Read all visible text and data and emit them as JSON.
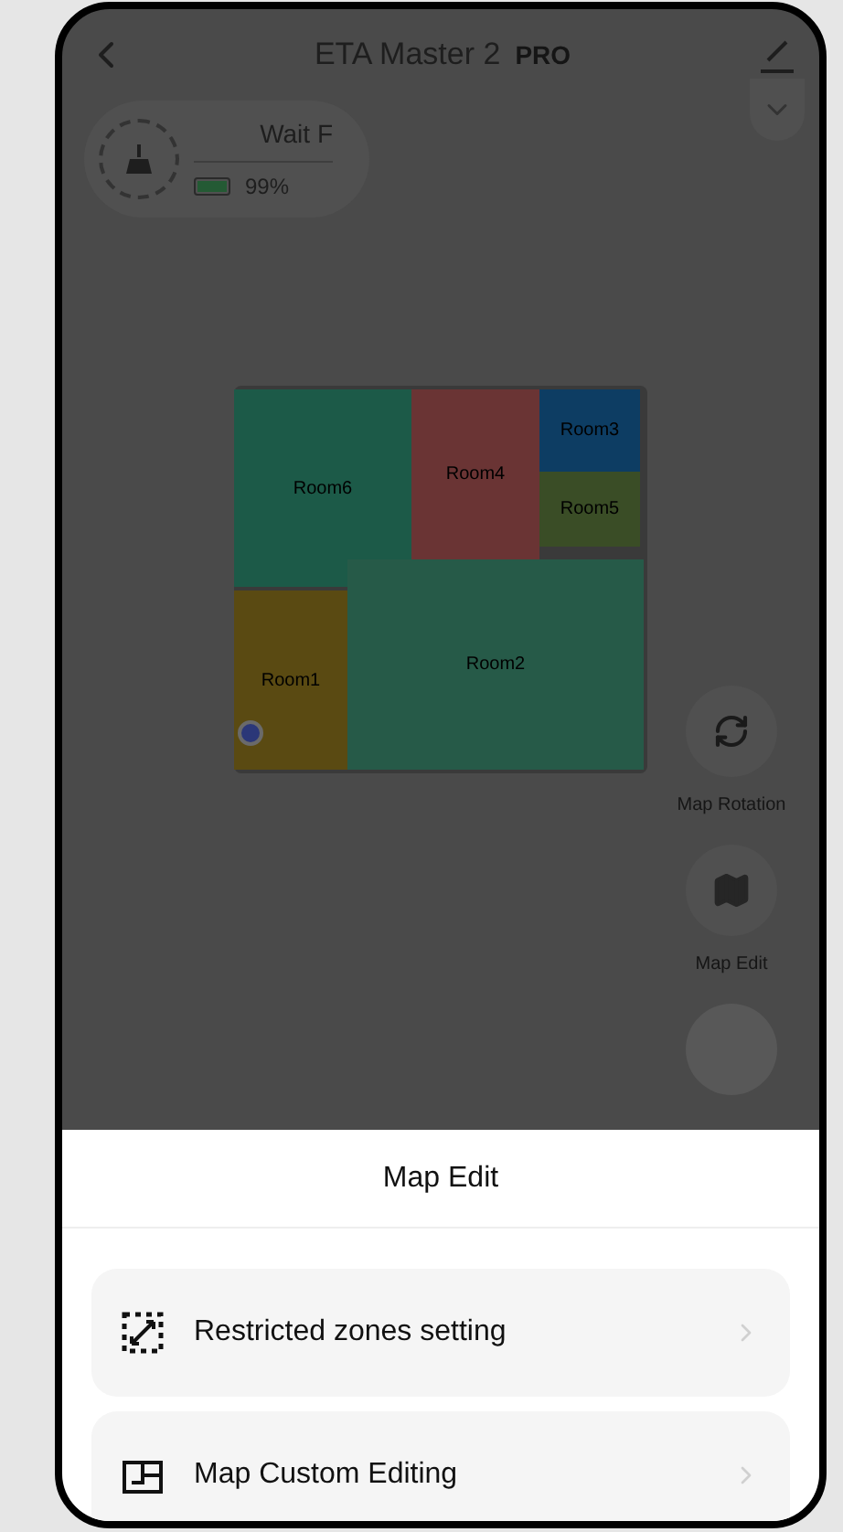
{
  "header": {
    "title": "ETA Master 2",
    "badge": "PRO"
  },
  "status": {
    "state": "Wait F",
    "battery": "99%",
    "level": 0.99
  },
  "rooms": [
    {
      "name": "Room6",
      "color": "#1c5a48"
    },
    {
      "name": "Room4",
      "color": "#6a3434"
    },
    {
      "name": "Room3",
      "color": "#0d3d63"
    },
    {
      "name": "Room5",
      "color": "#3a4d26"
    },
    {
      "name": "Room1",
      "color": "#5a4a12"
    },
    {
      "name": "Room2",
      "color": "#265a48"
    }
  ],
  "side_actions": [
    {
      "label": "Map Rotation",
      "kind": "rotate"
    },
    {
      "label": "Map Edit",
      "kind": "map"
    }
  ],
  "sheet": {
    "title": "Map Edit",
    "items": [
      {
        "label": "Restricted zones setting",
        "kind": "zone"
      },
      {
        "label": "Map Custom Editing",
        "kind": "custom"
      }
    ]
  }
}
